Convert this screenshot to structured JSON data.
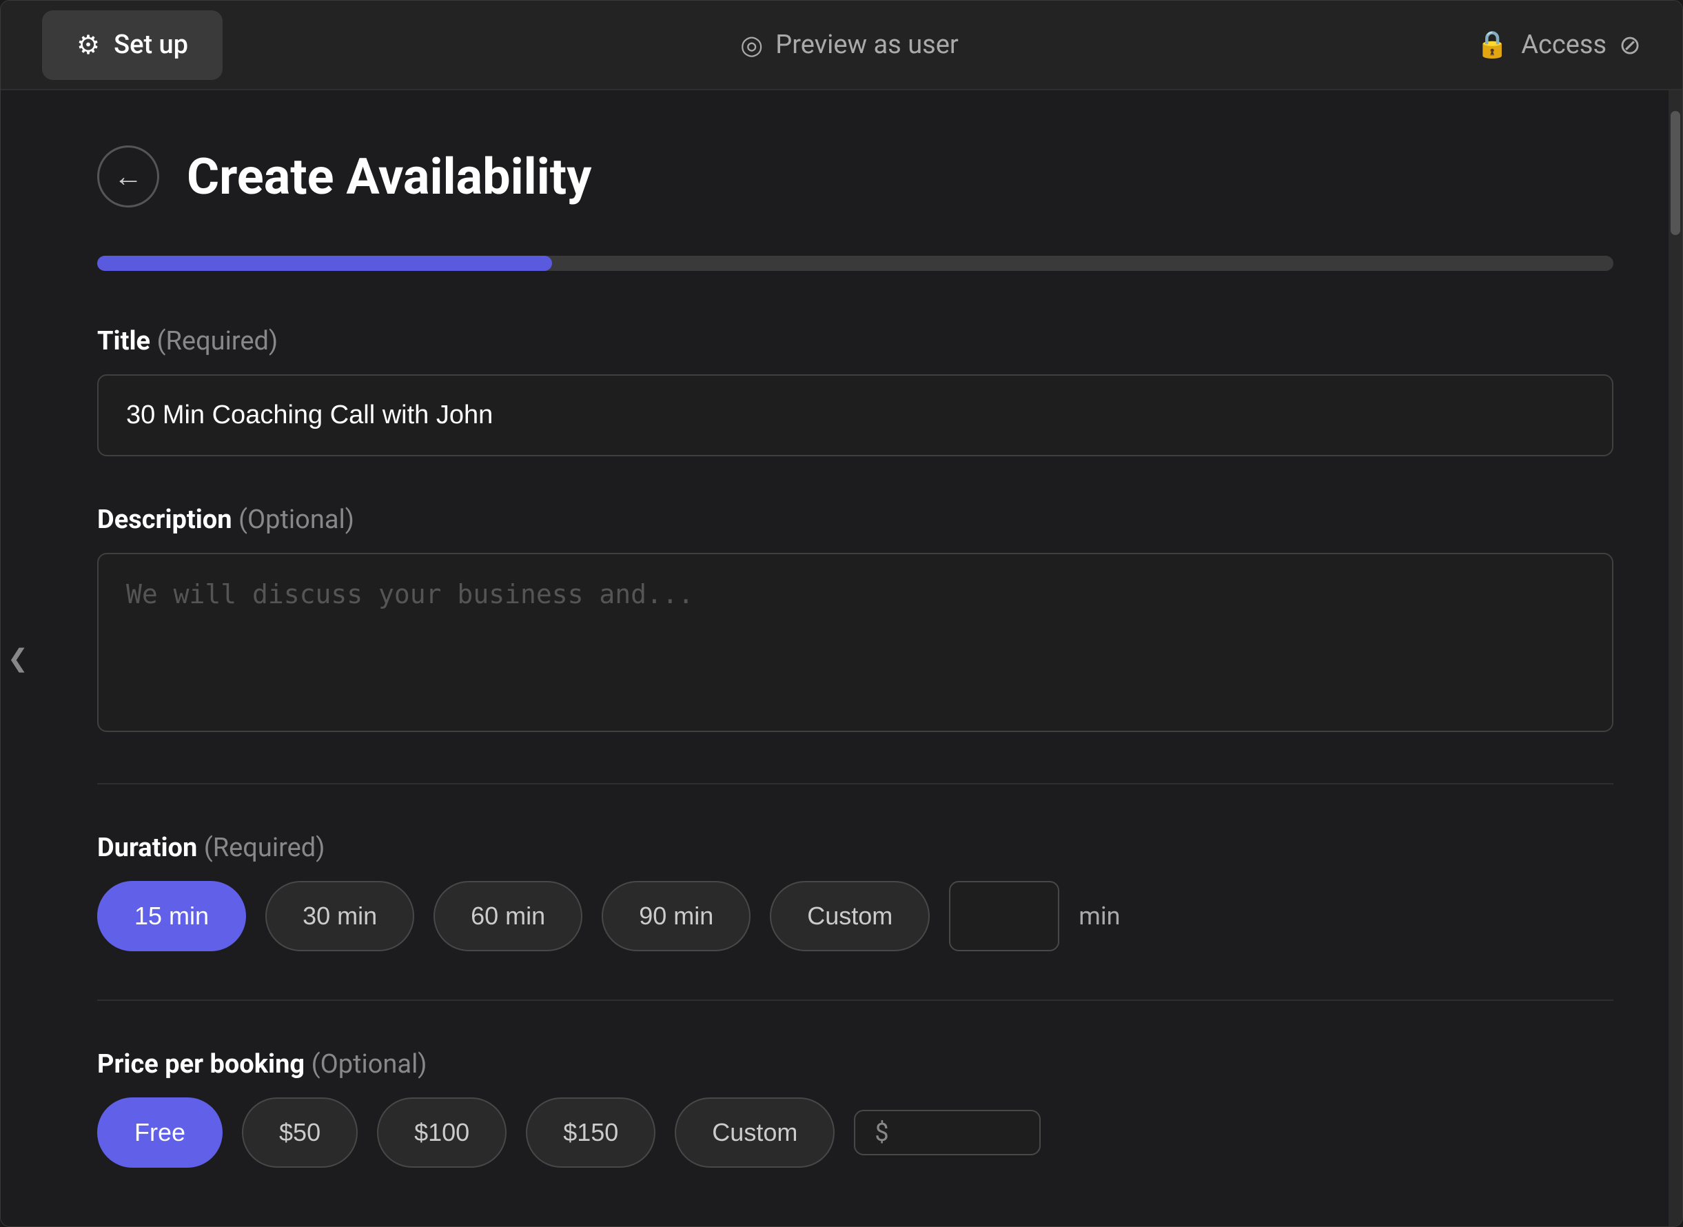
{
  "topbar": {
    "setup_label": "Set up",
    "setup_icon": "⚙",
    "preview_icon": "◎",
    "preview_label": "Preview as user",
    "access_icon": "🔒",
    "access_label": "Access",
    "access_slash_icon": "⊘"
  },
  "page": {
    "title": "Create Availability",
    "back_icon": "←"
  },
  "progress": {
    "fill_percent": 30
  },
  "form": {
    "title_label": "Title",
    "title_required": "(Required)",
    "title_value": "30 Min Coaching Call with John",
    "description_label": "Description",
    "description_optional": "(Optional)",
    "description_placeholder": "We will discuss your business and...",
    "duration_label": "Duration",
    "duration_required": "(Required)",
    "duration_options": [
      "15 min",
      "30 min",
      "60 min",
      "90 min",
      "Custom"
    ],
    "duration_selected": "15 min",
    "duration_custom_placeholder": "",
    "duration_unit": "min",
    "price_label": "Price per booking",
    "price_optional": "(Optional)",
    "price_options": [
      "Free",
      "$50",
      "$100",
      "$150",
      "Custom"
    ],
    "price_selected": "Free",
    "price_custom_placeholder": "$"
  },
  "sidebar": {
    "toggle_icon": "❮"
  }
}
